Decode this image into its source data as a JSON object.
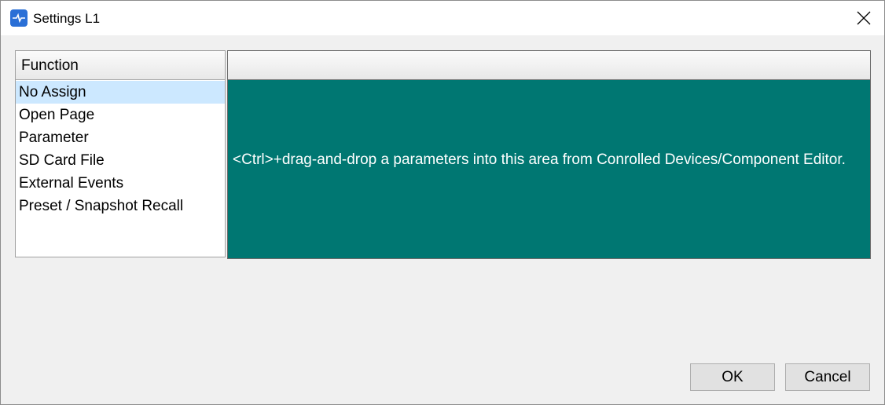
{
  "window": {
    "title": "Settings L1"
  },
  "function_panel": {
    "header": "Function",
    "items": [
      {
        "label": "No Assign",
        "selected": true
      },
      {
        "label": "Open Page",
        "selected": false
      },
      {
        "label": "Parameter",
        "selected": false
      },
      {
        "label": "SD Card File",
        "selected": false
      },
      {
        "label": "External Events",
        "selected": false
      },
      {
        "label": "Preset / Snapshot Recall",
        "selected": false
      }
    ]
  },
  "assign_panel": {
    "header": "",
    "hint": "<Ctrl>+drag-and-drop a parameters into this area from Conrolled Devices/Component Editor."
  },
  "buttons": {
    "ok": "OK",
    "cancel": "Cancel"
  },
  "colors": {
    "drop_area": "#007772",
    "selection": "#cce8ff",
    "app_icon": "#2a6fd6"
  },
  "icons": {
    "app": "app-logo-icon",
    "close": "close-icon"
  }
}
